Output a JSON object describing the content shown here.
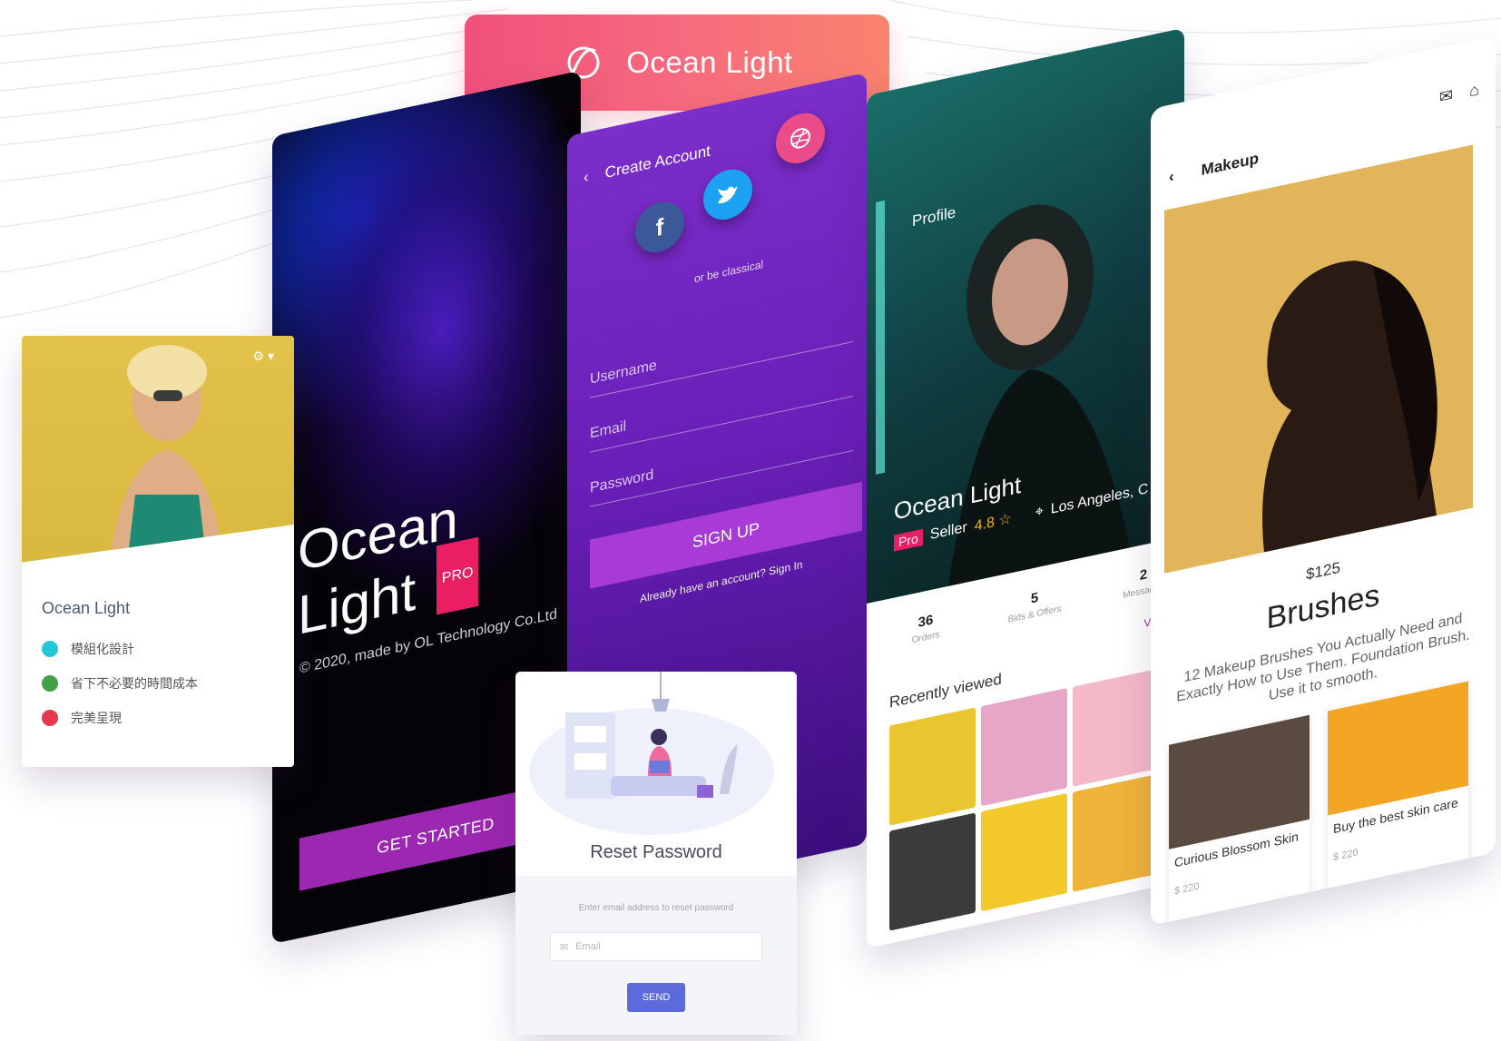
{
  "banner": {
    "title": "Ocean Light"
  },
  "hero": {
    "title_line1": "Ocean",
    "title_line2": "Light",
    "badge": "PRO",
    "copyright": "© 2020, made by OL Technology Co.Ltd",
    "cta": "GET STARTED"
  },
  "signup": {
    "title": "Create Account",
    "alt_text": "or be classical",
    "username_placeholder": "Username",
    "email_placeholder": "Email",
    "password_placeholder": "Password",
    "button": "SIGN UP",
    "signin_note": "Already have an account? Sign In",
    "social": [
      "f",
      "t",
      "d"
    ]
  },
  "reset": {
    "title": "Reset Password",
    "hint": "Enter email address to reset password",
    "email_placeholder": "Email",
    "button": "SEND"
  },
  "card": {
    "title": "Ocean Light",
    "items": [
      {
        "label": "模組化設計",
        "color": "#26c6da"
      },
      {
        "label": "省下不必要的時間成本",
        "color": "#43a047"
      },
      {
        "label": "完美呈現",
        "color": "#e53950"
      }
    ]
  },
  "profile": {
    "label": "Profile",
    "name": "Ocean Light",
    "badge": "Pro",
    "role": "Seller",
    "rating": "4.8 ☆",
    "location": "Los Angeles, C",
    "stats": [
      {
        "value": "36",
        "label": "Orders"
      },
      {
        "value": "5",
        "label": "Bids & Offers"
      },
      {
        "value": "2",
        "label": "Messages"
      }
    ],
    "view_all": "View A",
    "recent_title": "Recently viewed",
    "thumb_colors": [
      "#e9c62f",
      "#e7a6c7",
      "#f4b9c8",
      "#3b3b3b",
      "#f2c82b",
      "#f0b33a"
    ]
  },
  "shop": {
    "title": "Makeup",
    "price": "$125",
    "product": "Brushes",
    "description": "12 Makeup Brushes You Actually Need and Exactly How to Use Them. Foundation Brush. Use it to smooth.",
    "items": [
      {
        "name": "Curious Blossom Skin",
        "price": "$ 220",
        "color": "#5a4a40"
      },
      {
        "name": "Buy the best skin care",
        "price": "$ 220",
        "color": "#f2a623"
      }
    ]
  }
}
